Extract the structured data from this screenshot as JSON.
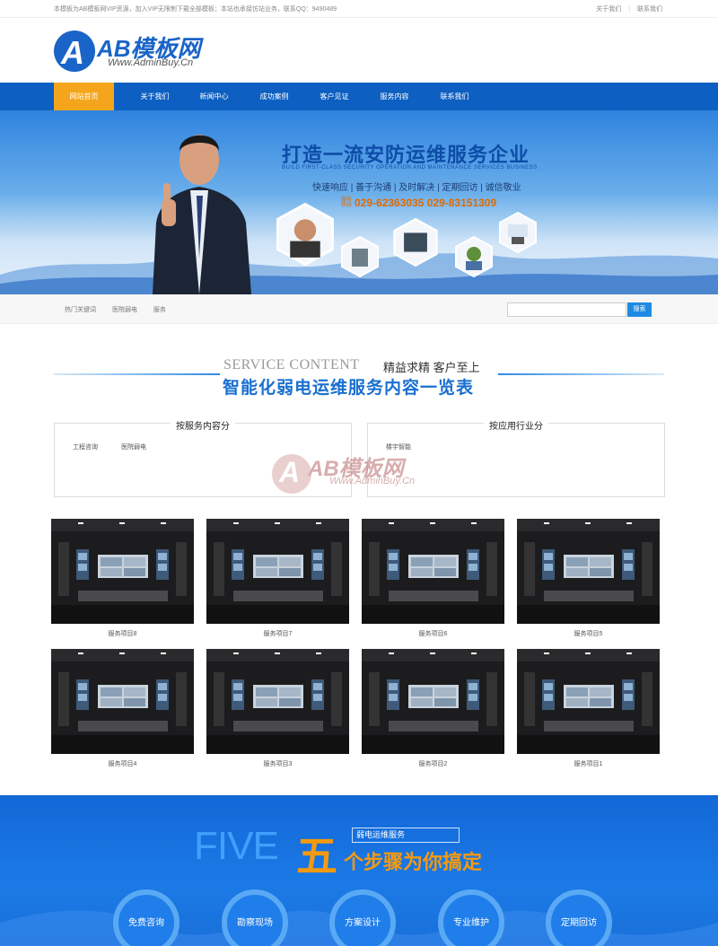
{
  "topbar": {
    "notice": "本模板为AB模板网VIP资源，加入VIP无限制下载全部模板；本站也承接仿站业务，联系QQ：9490489",
    "about_link": "关于我们",
    "contact_link": "联系我们"
  },
  "logo": {
    "mark": "A",
    "name": "AB模板网",
    "url": "Www.AdminBuy.Cn"
  },
  "nav": {
    "items": [
      "网站首页",
      "关于我们",
      "新闻中心",
      "成功案例",
      "客户见证",
      "服务内容",
      "联系我们"
    ],
    "active_index": 0
  },
  "banner": {
    "title": "打造一流安防运维服务企业",
    "subtitle": "BUILD FIRST-CLASS SECURITY OPERATION AND MAINTENANCE SERVICES BUSINESS",
    "slogan": "快速响应 | 善于沟通 | 及时解决 | 定期回访 | 诚信敬业",
    "hotline_label": "服务热线",
    "phones": "029-62363035  029-83151309"
  },
  "search": {
    "hot_label": "热门关键词",
    "hot_words": [
      "医院弱电",
      "服务"
    ],
    "placeholder": "",
    "button": "搜索"
  },
  "section": {
    "en": "SERVICE CONTENT",
    "cn": "精益求精 客户至上",
    "title": "智能化弱电运维服务内容一览表"
  },
  "categories": [
    {
      "title": "按服务内容分",
      "options": [
        "工程咨询",
        "医院弱电"
      ]
    },
    {
      "title": "按应用行业分",
      "options": [
        "楼宇智能"
      ]
    }
  ],
  "watermark": {
    "name": "AB模板网",
    "url": "Www.AdminBuy.Cn"
  },
  "products": [
    {
      "caption": "服务项目8"
    },
    {
      "caption": "服务项目7"
    },
    {
      "caption": "服务项目6"
    },
    {
      "caption": "服务项目5"
    },
    {
      "caption": "服务项目4"
    },
    {
      "caption": "服务项目3"
    },
    {
      "caption": "服务项目2"
    },
    {
      "caption": "服务项目1"
    }
  ],
  "steps": {
    "five_en": "FIVE",
    "five_cn": "五",
    "tag": "弱电运维服务",
    "title": "个步骤为你搞定",
    "items": [
      "免费咨询",
      "勘察现场",
      "方案设计",
      "专业维护",
      "定期回访"
    ]
  },
  "colors": {
    "nav_blue": "#0d5fc1",
    "nav_active": "#f4a51c",
    "accent_blue": "#1a6fd0",
    "orange": "#f49a11"
  }
}
